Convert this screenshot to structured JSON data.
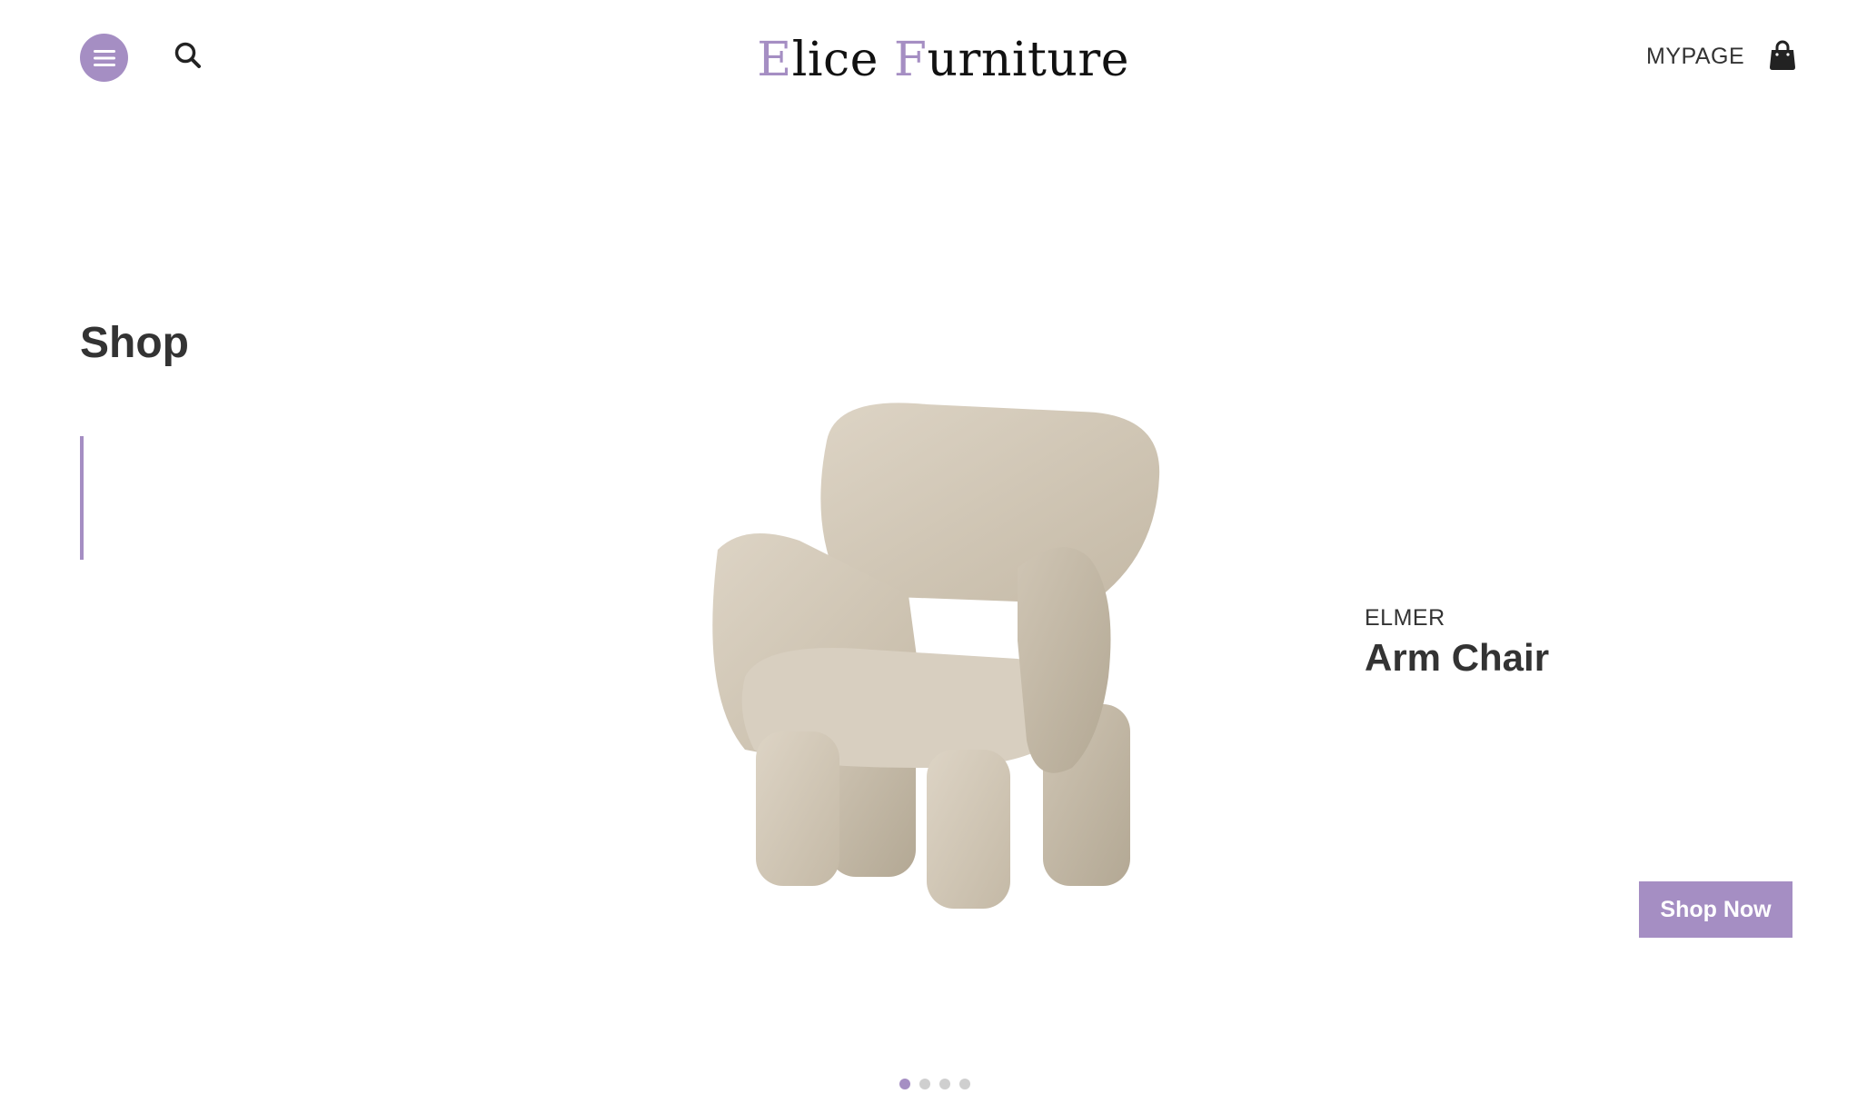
{
  "header": {
    "menu_icon": "hamburger-menu-icon",
    "search_icon": "search-icon",
    "logo": {
      "icon": "lamp-logo-icon",
      "text_part1_initial": "E",
      "text_part1_rest": "lice ",
      "text_part2_initial": "F",
      "text_part2_rest": "urniture"
    },
    "mypage_label": "MYPAGE",
    "cart_icon": "shopping-bag-icon"
  },
  "hero": {
    "section_title": "Shop",
    "product_image": "arm-chair-image",
    "brand": "ELMER",
    "product_name": "Arm Chair",
    "cta_label": "Shop Now"
  },
  "carousel": {
    "total_slides": 4,
    "active_index": 0
  },
  "colors": {
    "accent": "#a58ec3",
    "text": "#333333",
    "background": "#ffffff",
    "dot_inactive": "#cfcfcf"
  }
}
